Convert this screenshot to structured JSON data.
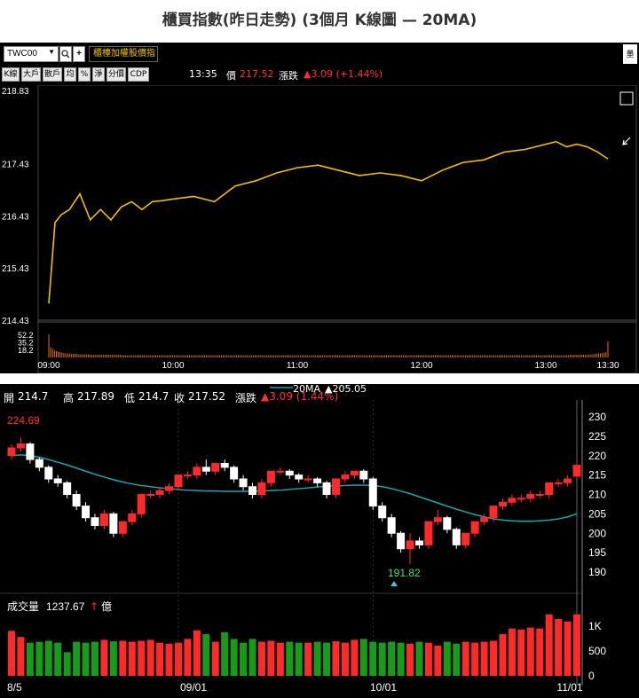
{
  "page": {
    "title": "櫃買指數(昨日走勢) (3個月 K線圖 — 20MA)"
  },
  "toolbar": {
    "symbol": "TWC00",
    "search_icon": "search-icon",
    "add_icon": "plus-icon",
    "index_name": "櫃檯加權股價指",
    "right_label": "墨",
    "buttons": [
      "K線",
      "大戶",
      "散戶",
      "均",
      "%",
      "淨",
      "分價",
      "CDP"
    ],
    "time": "13:35",
    "price_label": "價",
    "price": "217.52",
    "change_label": "漲跌",
    "change": "▲3.09 (+1.44%)",
    "link_icon": "link-icon"
  },
  "colors": {
    "up": "#ff2a2a",
    "down": "#ffffff",
    "vol_down": "#1a9a1a",
    "ma": "#1aa6b0",
    "intraday": "#f0c000"
  },
  "chart_data": [
    {
      "type": "line",
      "title": "",
      "series": [
        {
          "name": "",
          "x": [
            "09:00",
            "09:03",
            "09:06",
            "09:10",
            "09:15",
            "09:20",
            "09:25",
            "09:30",
            "09:35",
            "09:40",
            "09:45",
            "09:50",
            "09:55",
            "10:00",
            "10:10",
            "10:20",
            "10:30",
            "10:40",
            "10:50",
            "11:00",
            "11:10",
            "11:20",
            "11:30",
            "11:40",
            "11:50",
            "12:00",
            "12:10",
            "12:20",
            "12:30",
            "12:40",
            "12:50",
            "13:00",
            "13:05",
            "13:10",
            "13:15",
            "13:20",
            "13:25",
            "13:30"
          ],
          "values": [
            214.75,
            216.3,
            216.45,
            216.55,
            216.85,
            216.35,
            216.55,
            216.35,
            216.6,
            216.7,
            216.55,
            216.7,
            216.72,
            216.75,
            216.8,
            216.7,
            217.0,
            217.1,
            217.25,
            217.35,
            217.4,
            217.3,
            217.2,
            217.25,
            217.2,
            217.1,
            217.3,
            217.45,
            217.5,
            217.65,
            217.7,
            217.8,
            217.85,
            217.75,
            217.8,
            217.75,
            217.65,
            217.52
          ]
        }
      ],
      "yticks": [
        218.83,
        217.43,
        216.43,
        215.43,
        214.43
      ],
      "volume_ticks": [
        52.2,
        35.2,
        18.2
      ],
      "xticks": [
        "09:00",
        "10:00",
        "11:00",
        "12:00",
        "13:00",
        "13:30"
      ],
      "volume": [
        52,
        23,
        19,
        16,
        14,
        13,
        12,
        11,
        10,
        9,
        9,
        9,
        8,
        8,
        8,
        8,
        7,
        7,
        7,
        7,
        7,
        7,
        6,
        6,
        6,
        6,
        6,
        6,
        6,
        6,
        6,
        6,
        6,
        6,
        6,
        6,
        6,
        6,
        6,
        5,
        5,
        5,
        5,
        5,
        5,
        5,
        5,
        5,
        5,
        5,
        5,
        5,
        5,
        5,
        5,
        5,
        5,
        5,
        5,
        5,
        5,
        5,
        5,
        5,
        5,
        5,
        5,
        5,
        5,
        5,
        5,
        5,
        5,
        5,
        5,
        5,
        5,
        5,
        5,
        5,
        5,
        5,
        5,
        5,
        5,
        5,
        5,
        5,
        5,
        5,
        5,
        5,
        5,
        5,
        5,
        5,
        5,
        5,
        5,
        5,
        5,
        5,
        5,
        5,
        5,
        5,
        5,
        5,
        5,
        5,
        5,
        5,
        5,
        5,
        5,
        5,
        5,
        5,
        5,
        5,
        5,
        5,
        5,
        5,
        5,
        5,
        5,
        5,
        5,
        5,
        5,
        5,
        5,
        5,
        5,
        5,
        5,
        5,
        5,
        5,
        5,
        5,
        5,
        5,
        5,
        5,
        5,
        5,
        5,
        5,
        5,
        5,
        5,
        5,
        5,
        5,
        5,
        5,
        5,
        5,
        5,
        5,
        5,
        5,
        5,
        5,
        5,
        5,
        5,
        5,
        5,
        5,
        5,
        5,
        5,
        5,
        5,
        5,
        5,
        5,
        5,
        5,
        5,
        5,
        5,
        5,
        5,
        5,
        5,
        5,
        5,
        5,
        5,
        5,
        5,
        5,
        5,
        5,
        5,
        5,
        5,
        5,
        5,
        5,
        5,
        5,
        5,
        5,
        5,
        5,
        5,
        5,
        5,
        5,
        5,
        5,
        5,
        5,
        5,
        5,
        5,
        5,
        5,
        5,
        5,
        5,
        5,
        5,
        5,
        5,
        5,
        5,
        5,
        5,
        5,
        5,
        5,
        5,
        5,
        5,
        5,
        5,
        5,
        5,
        5,
        5,
        5,
        5,
        5,
        5,
        5,
        5,
        5,
        5,
        5,
        5,
        5,
        5,
        5,
        5,
        5,
        5,
        5,
        5,
        5,
        5,
        5,
        5,
        5,
        5,
        5,
        5,
        5,
        5,
        5,
        5,
        5,
        5,
        6,
        6,
        6,
        6,
        6,
        6,
        6,
        6,
        6,
        6,
        7,
        7,
        7,
        8,
        8,
        9,
        9,
        10,
        11,
        12,
        36
      ]
    },
    {
      "type": "candlestick",
      "title": "",
      "header": {
        "open_label": "開",
        "open": "214.7",
        "high_label": "高",
        "high": "217.89",
        "low_label": "低",
        "low": "214.7",
        "close_label": "收",
        "close": "217.52",
        "change_label": "漲跌",
        "change": "▲3.09 (1.44%)",
        "ma_label": "20MA",
        "ma_value": "▲205.05"
      },
      "annotations": {
        "high": "224.69",
        "low": "191.82"
      },
      "volume_label": "成交量",
      "volume_value": "1237.67",
      "volume_unit_arrow": "↑",
      "volume_unit": "億",
      "yticks": [
        230,
        225,
        220,
        215,
        210,
        205,
        200,
        195,
        190
      ],
      "volume_ticks": [
        "1K",
        "500",
        "0"
      ],
      "xticks": [
        "8/5",
        "09/01",
        "10/01",
        "11/01"
      ],
      "candles": [
        [
          220,
          223,
          219,
          222,
          950
        ],
        [
          222,
          224.69,
          221,
          223,
          820
        ],
        [
          223,
          223.5,
          218,
          219,
          700
        ],
        [
          219,
          219.5,
          216,
          217,
          720
        ],
        [
          217,
          217.5,
          213,
          214,
          740
        ],
        [
          214,
          215,
          212,
          213,
          700
        ],
        [
          213,
          213.5,
          209,
          210,
          500
        ],
        [
          210,
          211,
          206,
          207,
          720
        ],
        [
          207,
          208,
          203,
          204,
          700
        ],
        [
          204,
          205,
          201,
          202,
          720
        ],
        [
          202,
          206,
          201,
          205,
          760
        ],
        [
          205,
          205.5,
          199,
          200,
          730
        ],
        [
          200,
          203,
          199,
          203,
          740
        ],
        [
          203,
          206,
          202,
          205,
          720
        ],
        [
          205,
          210,
          204,
          210,
          740
        ],
        [
          210,
          211,
          209,
          210,
          760
        ],
        [
          210,
          212,
          209,
          211,
          700
        ],
        [
          211,
          213,
          210,
          212,
          680
        ],
        [
          212,
          215,
          211,
          215,
          700
        ],
        [
          215,
          216,
          214,
          215,
          780
        ],
        [
          215,
          218,
          214,
          217,
          960
        ],
        [
          217,
          219,
          215,
          216,
          880
        ],
        [
          216,
          218,
          215,
          218,
          720
        ],
        [
          218,
          219,
          216,
          217,
          920
        ],
        [
          217,
          217.5,
          213,
          214,
          780
        ],
        [
          214,
          215,
          211,
          212,
          700
        ],
        [
          212,
          213,
          209,
          210,
          780
        ],
        [
          210,
          214,
          209,
          213,
          720
        ],
        [
          213,
          216,
          212,
          216,
          740
        ],
        [
          216,
          217,
          215,
          216,
          700
        ],
        [
          216,
          216.5,
          214,
          215,
          720
        ],
        [
          215,
          215.5,
          213,
          214,
          700
        ],
        [
          214,
          215,
          213,
          214,
          700
        ],
        [
          214,
          214.5,
          212,
          213,
          720
        ],
        [
          213,
          213.5,
          209,
          210,
          700
        ],
        [
          210,
          214,
          209,
          214,
          730
        ],
        [
          214,
          216,
          213,
          215,
          700
        ],
        [
          215,
          216,
          214,
          216,
          760
        ],
        [
          216,
          216.5,
          213,
          214,
          780
        ],
        [
          214,
          214.5,
          206,
          207,
          720
        ],
        [
          207,
          208,
          203,
          204,
          700
        ],
        [
          204,
          205,
          199,
          200,
          720
        ],
        [
          200,
          200.5,
          195,
          196,
          700
        ],
        [
          196,
          200,
          192,
          198,
          680
        ],
        [
          198,
          199,
          196,
          197,
          720
        ],
        [
          197,
          203,
          196,
          203,
          700
        ],
        [
          203,
          206,
          202,
          204,
          640
        ],
        [
          204,
          204.5,
          200,
          201,
          720
        ],
        [
          201,
          201.5,
          196,
          197,
          680
        ],
        [
          197,
          200,
          196,
          200,
          720
        ],
        [
          200,
          203,
          199,
          203,
          700
        ],
        [
          203,
          205,
          202,
          204,
          720
        ],
        [
          204,
          207,
          203,
          207,
          740
        ],
        [
          207,
          209,
          206,
          208,
          880
        ],
        [
          208,
          210,
          207,
          209,
          1000
        ],
        [
          209,
          210,
          208,
          209,
          980
        ],
        [
          209,
          211,
          208,
          210,
          1020
        ],
        [
          210,
          211,
          209,
          210,
          1000
        ],
        [
          210,
          213,
          209,
          213,
          1300
        ],
        [
          213,
          214,
          212,
          213,
          1200
        ],
        [
          213,
          215,
          212,
          214,
          1150
        ],
        [
          214.7,
          217.89,
          214.7,
          217.52,
          1300
        ]
      ],
      "ma20": [
        220,
        220.2,
        220,
        219.6,
        219,
        218.3,
        217.6,
        216.8,
        216,
        215.2,
        214.5,
        213.8,
        213.2,
        212.7,
        212.3,
        212,
        211.7,
        211.5,
        211.3,
        211.1,
        211,
        210.9,
        210.9,
        210.8,
        210.8,
        210.8,
        210.8,
        210.9,
        211,
        211.1,
        211.3,
        211.5,
        211.7,
        211.9,
        212.1,
        212.2,
        212.3,
        212.4,
        212.4,
        212.3,
        212,
        211.5,
        210.9,
        210.2,
        209.4,
        208.6,
        207.8,
        207,
        206.2,
        205.5,
        204.8,
        204.2,
        203.7,
        203.4,
        203.2,
        203.1,
        203.1,
        203.2,
        203.4,
        203.7,
        204.2,
        205.05
      ]
    }
  ]
}
